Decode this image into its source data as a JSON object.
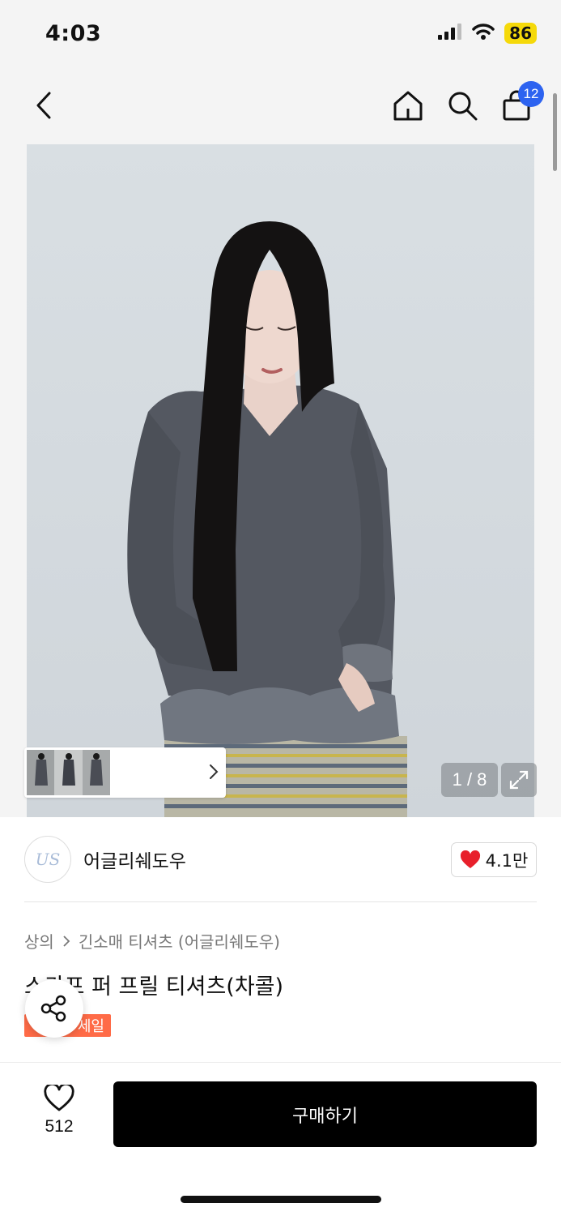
{
  "status_bar": {
    "time": "4:03",
    "battery": "86"
  },
  "nav": {
    "cart_count": "12"
  },
  "gallery": {
    "counter": "1 / 8"
  },
  "brand": {
    "logo_text": "US",
    "name": "어글리쉐도우",
    "likes": "4.1만"
  },
  "breadcrumb": {
    "category": "상의",
    "subcategory": "긴소매 티셔츠 (어글리쉐도우)"
  },
  "product": {
    "title": "스카프 퍼 프릴 티셔츠(차콜)",
    "badge": "세일"
  },
  "bottom_bar": {
    "wish_count": "512",
    "buy_label": "구매하기"
  },
  "colors": {
    "accent_blue": "#2d63f0",
    "sale_orange": "#ff6b47",
    "heart_red": "#e8202b",
    "battery_yellow": "#f5d90a"
  },
  "icons": [
    "back-icon",
    "home-icon",
    "search-icon",
    "bag-icon",
    "chevron-right-icon",
    "expand-icon",
    "heart-icon",
    "share-icon",
    "wifi-icon",
    "signal-icon"
  ]
}
